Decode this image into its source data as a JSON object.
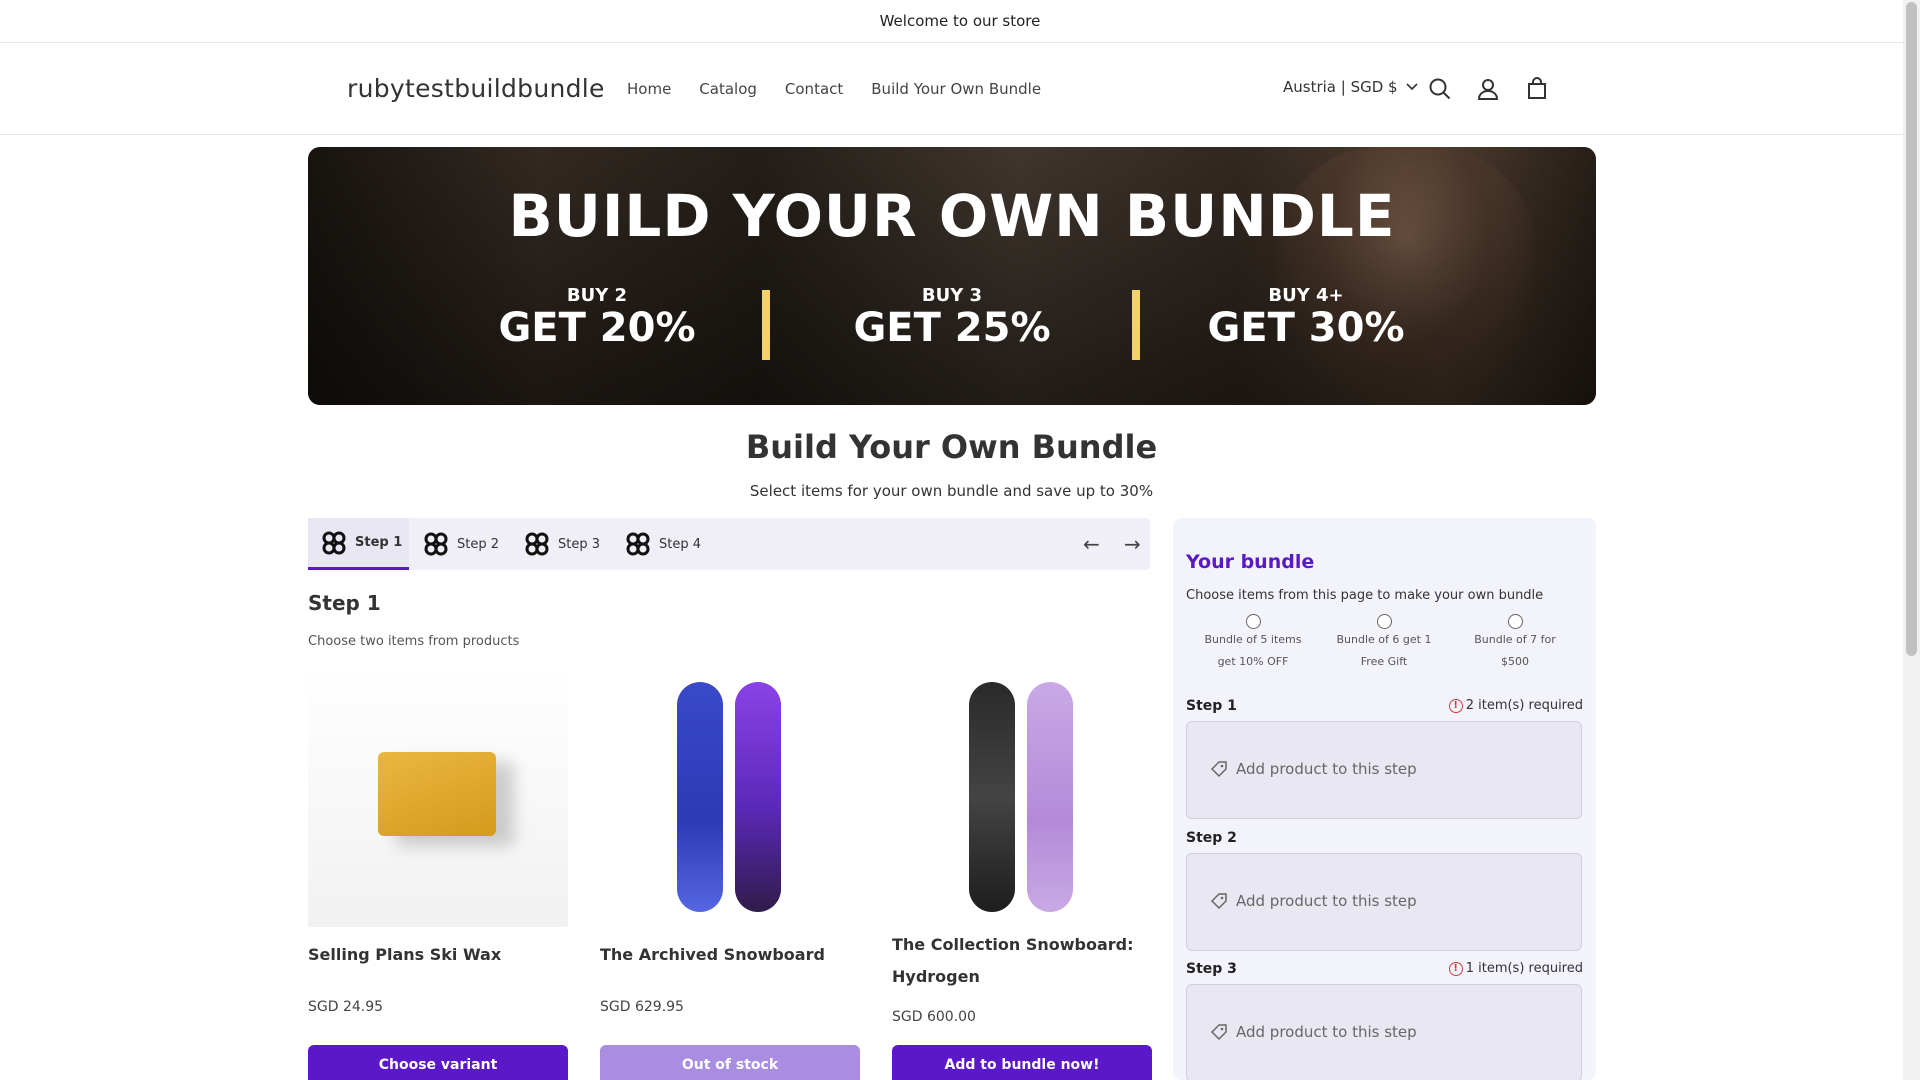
{
  "announcement": "Welcome to our store",
  "header": {
    "logo": "rubytestbuildbundle",
    "nav": [
      "Home",
      "Catalog",
      "Contact",
      "Build Your Own Bundle"
    ],
    "country": "Austria | SGD $"
  },
  "hero": {
    "title": "BUILD YOUR OWN BUNDLE",
    "deals": [
      {
        "small": "BUY 2",
        "big": "GET 20%"
      },
      {
        "small": "BUY 3",
        "big": "GET 25%"
      },
      {
        "small": "BUY 4+",
        "big": "GET 30%"
      }
    ]
  },
  "page": {
    "title": "Build Your Own Bundle",
    "subtitle": "Select items for your own bundle and save up to 30%"
  },
  "steps": [
    "Step 1",
    "Step 2",
    "Step 3",
    "Step 4"
  ],
  "current_step": {
    "title": "Step 1",
    "description": "Choose two items from products"
  },
  "products": [
    {
      "name": "Selling Plans Ski Wax",
      "price": "SGD 24.95",
      "button": "Choose variant",
      "button_color": "#5a18c9"
    },
    {
      "name": "The Archived Snowboard",
      "price": "SGD 629.95",
      "button": "Out of stock",
      "button_color": "#a98de0"
    },
    {
      "name": "The Collection Snowboard: Hydrogen",
      "price": "SGD 600.00",
      "button": "Add to bundle now!",
      "button_color": "#5a18c9"
    }
  ],
  "bundle": {
    "title": "Your bundle",
    "subtitle": "Choose items from this page to make your own bundle",
    "options": [
      {
        "line1": "Bundle of 5 items",
        "line2": "get 10% OFF"
      },
      {
        "line1": "Bundle of 6 get 1",
        "line2": "Free Gift"
      },
      {
        "line1": "Bundle of 7 for",
        "line2": "$500"
      }
    ],
    "slots": [
      {
        "label": "Step 1",
        "required": "2 item(s) required",
        "placeholder": "Add product to this step"
      },
      {
        "label": "Step 2",
        "required": "",
        "placeholder": "Add product to this step"
      },
      {
        "label": "Step 3",
        "required": "1 item(s) required",
        "placeholder": "Add product to this step"
      }
    ]
  },
  "colors": {
    "accent": "#5a18c9",
    "accent_light": "#a98de0",
    "error": "#d23b3b",
    "hero_bar": "#f2d36b"
  }
}
